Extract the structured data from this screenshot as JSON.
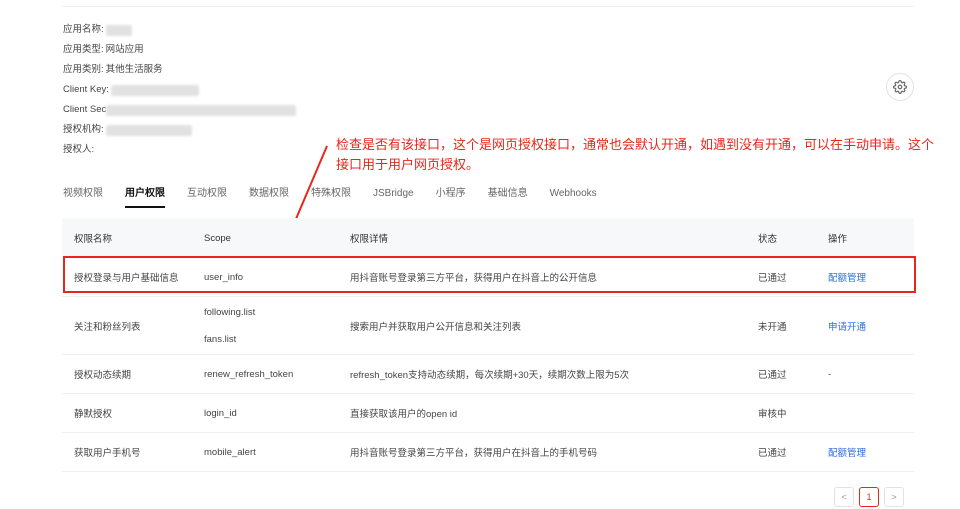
{
  "app_info": {
    "name_label": "应用名称:",
    "type_label": "应用类型:",
    "type_value": "网站应用",
    "category_label": "应用类别:",
    "category_value": "其他生活服务",
    "client_key_label": "Client Key:",
    "client_secret_label": "Client Sec",
    "auth_org_label": "授权机构:",
    "authorizer_label": "授权人:"
  },
  "annotation": {
    "text": "检查是否有该接口，这个是网页授权接口，通常也会默认开通，如遇到没有开通，可以在手动申请。这个接口用于用户网页授权。",
    "color": "#e8261c"
  },
  "tabs": [
    {
      "label": "视频权限",
      "active": false
    },
    {
      "label": "用户权限",
      "active": true
    },
    {
      "label": "互动权限",
      "active": false
    },
    {
      "label": "数据权限",
      "active": false
    },
    {
      "label": "特殊权限",
      "active": false
    },
    {
      "label": "JSBridge",
      "active": false
    },
    {
      "label": "小程序",
      "active": false
    },
    {
      "label": "基础信息",
      "active": false
    },
    {
      "label": "Webhooks",
      "active": false
    }
  ],
  "table": {
    "headers": [
      "权限名称",
      "Scope",
      "权限详情",
      "状态",
      "操作"
    ],
    "rows": [
      {
        "name": "授权登录与用户基础信息",
        "scopes": [
          "user_info"
        ],
        "detail": "用抖音账号登录第三方平台，获得用户在抖音上的公开信息",
        "status": "已通过",
        "action": "配额管理"
      },
      {
        "name": "关注和粉丝列表",
        "scopes": [
          "following.list",
          "fans.list"
        ],
        "detail": "搜索用户并获取用户公开信息和关注列表",
        "status": "未开通",
        "action": "申请开通"
      },
      {
        "name": "授权动态续期",
        "scopes": [
          "renew_refresh_token"
        ],
        "detail": "refresh_token支持动态续期，每次续期+30天，续期次数上限为5次",
        "status": "已通过",
        "action": "-"
      },
      {
        "name": "静默授权",
        "scopes": [
          "login_id"
        ],
        "detail": "直接获取该用户的open id",
        "status": "审核中",
        "action": ""
      },
      {
        "name": "获取用户手机号",
        "scopes": [
          "mobile_alert"
        ],
        "detail": "用抖音账号登录第三方平台，获得用户在抖音上的手机号码",
        "status": "已通过",
        "action": "配额管理"
      }
    ]
  },
  "pagination": {
    "prev": "<",
    "current": "1",
    "next": ">"
  },
  "colors": {
    "link": "#2a6ce5",
    "highlight": "#e8261c"
  },
  "icons": {
    "settings": "gear-icon"
  }
}
